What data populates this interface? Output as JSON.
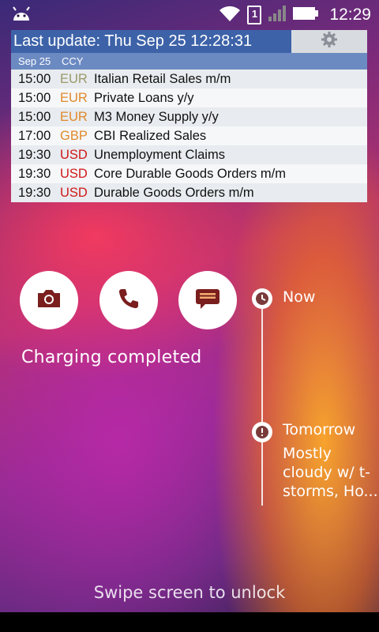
{
  "status_bar": {
    "sim_label": "1",
    "time": "12:29"
  },
  "widget": {
    "last_update": "Last update: Thu Sep 25 12:28:31",
    "column_headers": {
      "date": "Sep 25",
      "currency": "CCY"
    },
    "events": [
      {
        "time": "15:00",
        "currency": "EUR",
        "currency_color": "#9a9a6a",
        "title": "Italian Retail Sales m/m"
      },
      {
        "time": "15:00",
        "currency": "EUR",
        "currency_color": "#e08a2a",
        "title": "Private Loans y/y"
      },
      {
        "time": "15:00",
        "currency": "EUR",
        "currency_color": "#e08a2a",
        "title": "M3 Money Supply y/y"
      },
      {
        "time": "17:00",
        "currency": "GBP",
        "currency_color": "#e08a2a",
        "title": "CBI Realized Sales"
      },
      {
        "time": "19:30",
        "currency": "USD",
        "currency_color": "#d01818",
        "title": "Unemployment Claims"
      },
      {
        "time": "19:30",
        "currency": "USD",
        "currency_color": "#d01818",
        "title": "Core Durable Goods Orders m/m"
      },
      {
        "time": "19:30",
        "currency": "USD",
        "currency_color": "#d01818",
        "title": "Durable Goods Orders m/m"
      }
    ]
  },
  "shortcuts": [
    {
      "icon": "camera-icon"
    },
    {
      "icon": "phone-icon"
    },
    {
      "icon": "message-icon"
    }
  ],
  "lockscreen": {
    "charging_status": "Charging completed",
    "unlock_hint": "Swipe screen to unlock"
  },
  "weather": {
    "now_label": "Now",
    "tomorrow_label": "Tomorrow",
    "forecast_lines": [
      "Mostly",
      "cloudy w/ t-",
      "storms, Ho..."
    ]
  },
  "colors": {
    "header_blue": "#3d62a8",
    "subheader_blue": "#6c8ac2",
    "icon_maroon": "#7a1e1e"
  }
}
